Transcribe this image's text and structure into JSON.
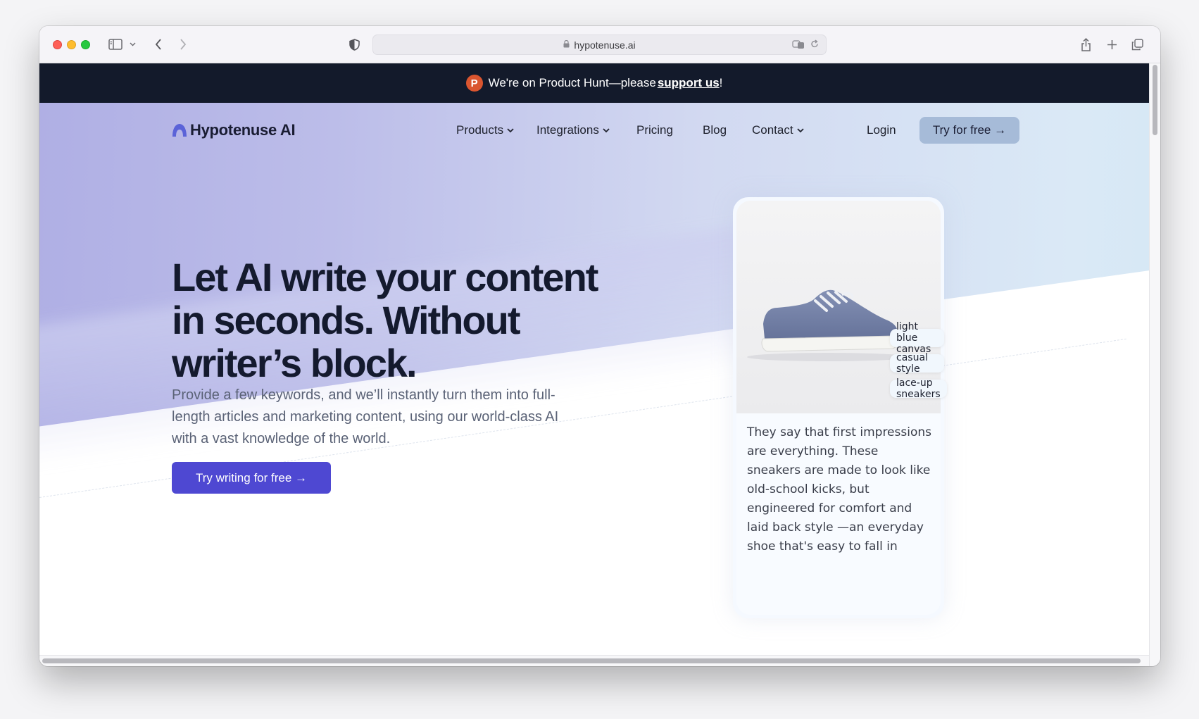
{
  "browser": {
    "url": "hypotenuse.ai"
  },
  "banner": {
    "badge": "P",
    "text": "We're on Product Hunt—please",
    "link": "support us",
    "suffix": "!"
  },
  "nav": {
    "brand": "Hypotenuse AI",
    "items": [
      {
        "label": "Products",
        "has_dropdown": true
      },
      {
        "label": "Integrations",
        "has_dropdown": true
      },
      {
        "label": "Pricing",
        "has_dropdown": false
      },
      {
        "label": "Blog",
        "has_dropdown": false
      },
      {
        "label": "Contact",
        "has_dropdown": true
      }
    ],
    "login": "Login",
    "try_free": "Try for free →"
  },
  "hero": {
    "headline_1": "Let AI write your content",
    "headline_2": "in seconds. Without",
    "headline_3": "writer’s block.",
    "subtitle": "Provide a few keywords, and we’ll instantly turn them into full-length articles and marketing content, using our world-class AI with a vast knowledge of the world.",
    "cta": "Try writing for free →"
  },
  "card": {
    "tags": [
      "light blue canvas",
      "casual style",
      "lace-up sneakers"
    ],
    "description": "They say that first impressions are everything. These sneakers are made to look like old-school kicks, but engineered for comfort and laid back style —an everyday shoe that's easy to fall in"
  },
  "colors": {
    "banner_bg": "#131a2b",
    "cta_bg": "#4e48d2",
    "nav_button_bg": "#a6bbd8",
    "product_hunt": "#da552f"
  }
}
